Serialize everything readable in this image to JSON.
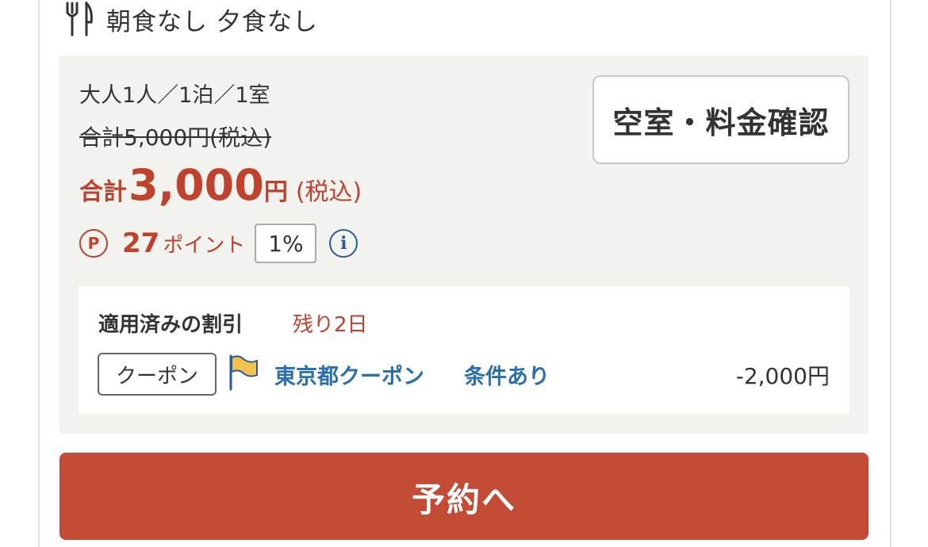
{
  "meals": {
    "label": "朝食なし 夕食なし",
    "icon": "fork-knife-icon"
  },
  "plan": {
    "occupancy": "大人1人／1泊／1室",
    "original_price": "合計5,000円(税込)",
    "price_prefix": "合計",
    "price_amount": "3,000",
    "price_yen": "円",
    "price_tax": "(税込)",
    "points_icon_label": "P",
    "points_value": "27",
    "points_unit": "ポイント",
    "points_rate": "1%",
    "info_icon_label": "i",
    "availability_button": "空室・料金確認"
  },
  "discount": {
    "title": "適用済みの割引",
    "remaining": "残り2日",
    "tag": "クーポン",
    "coupon_name": "東京都クーポン",
    "conditions_link": "条件あり",
    "amount": "-2,000円",
    "icon": "flag-icon"
  },
  "reserve_button": "予約へ",
  "colors": {
    "accent_red": "#c0412c",
    "button_red": "#c44b36",
    "link_blue": "#2a6fb0",
    "panel_bg": "#f2f3ef"
  }
}
